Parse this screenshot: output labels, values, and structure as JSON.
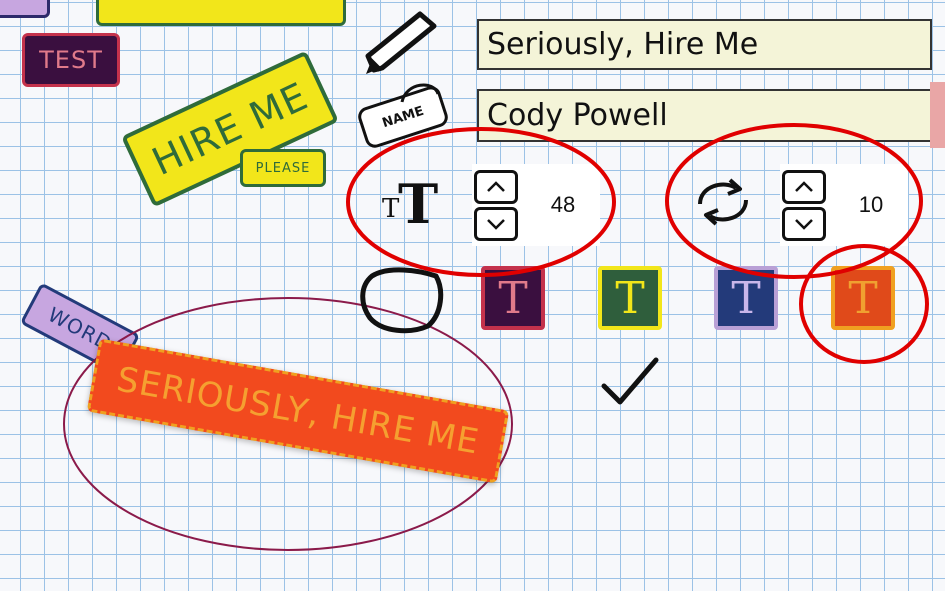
{
  "stickers": {
    "test": "TEST",
    "hire_me": "HIRE ME",
    "please": "PLEASE",
    "word": "WORD",
    "name_tag": "NAME",
    "main": "SERIOUSLY, HIRE ME"
  },
  "fields": {
    "sticker_text": "Seriously, Hire Me",
    "author_name": "Cody Powell"
  },
  "controls": {
    "font_size_value": "48",
    "rotation_value": "10",
    "swatch_letter": "T",
    "font_size_glyph": "T"
  },
  "colors": {
    "annotation_red": "#e00000",
    "selection_oval": "#8b1a4a",
    "swatches": [
      {
        "bg": "#3a0f3f",
        "border": "#c4324c",
        "fg": "#e07a8a"
      },
      {
        "bg": "#2f5e3c",
        "border": "#f2e61a",
        "fg": "#f2e61a"
      },
      {
        "bg": "#233a7a",
        "border": "#b9a0d6",
        "fg": "#c9b6ea"
      },
      {
        "bg": "#e04a1a",
        "border": "#f0a020",
        "fg": "#f0a030"
      }
    ]
  },
  "icons": {
    "pencil": "pencil-icon",
    "name_tag": "name-tag-icon",
    "font_size": "font-size-icon",
    "rotate": "rotate-icon",
    "shape": "blob-shape-icon",
    "confirm": "checkmark-icon"
  }
}
